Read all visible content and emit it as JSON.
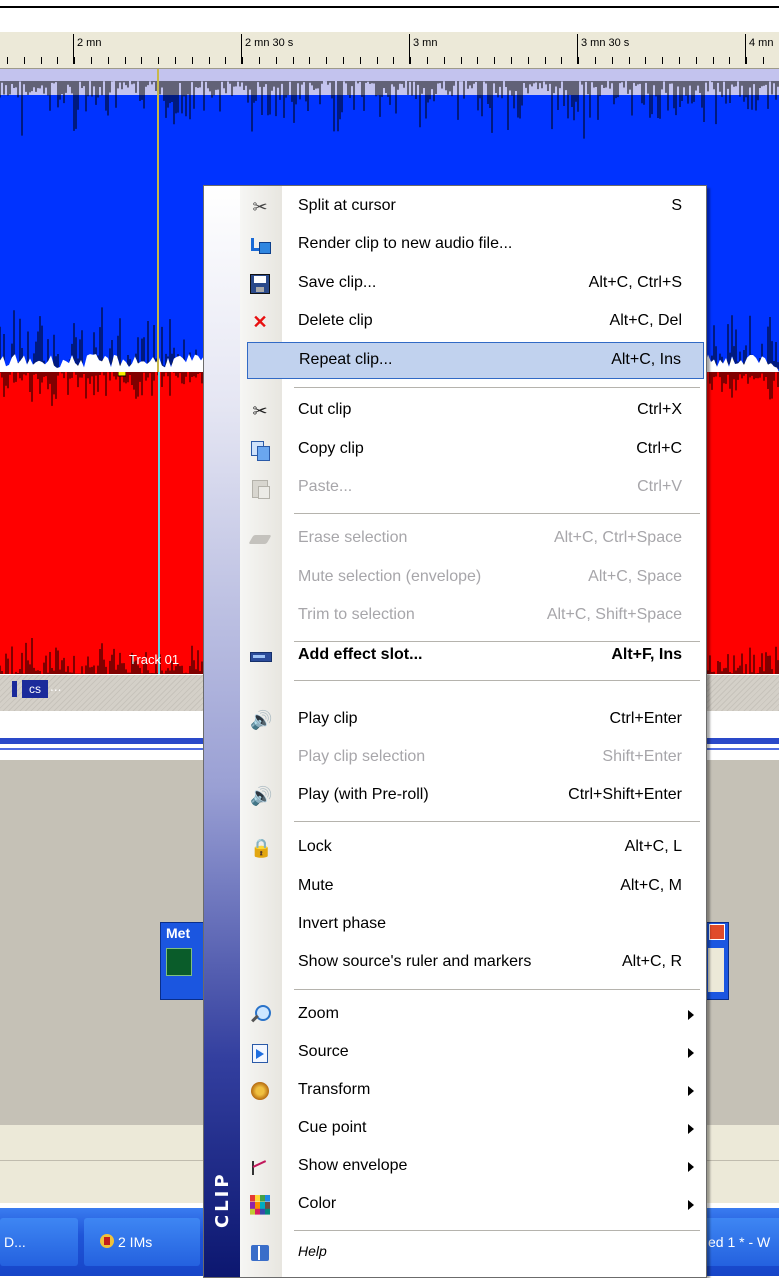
{
  "ruler": {
    "labels": [
      "2 mn",
      "2 mn 30 s",
      "3 mn",
      "3 mn 30 s",
      "4 mn"
    ]
  },
  "track": {
    "label": "Track 01",
    "clip_badge": "cs",
    "clip_more": "..."
  },
  "meter": {
    "title": "Met"
  },
  "taskbar": {
    "item_1": "D...",
    "item_2": "2 IMs",
    "item_3": "ed 1 * - W"
  },
  "menu": {
    "sidebar_title": "CLIP",
    "items": {
      "split_at_cursor": {
        "label": "Split at cursor",
        "shortcut": "S"
      },
      "render_clip": {
        "label": "Render clip to new audio file..."
      },
      "save_clip": {
        "label": "Save clip...",
        "shortcut": "Alt+C, Ctrl+S"
      },
      "delete_clip": {
        "label": "Delete clip",
        "shortcut": "Alt+C, Del"
      },
      "repeat_clip": {
        "label": "Repeat clip...",
        "shortcut": "Alt+C, Ins"
      },
      "cut_clip": {
        "label": "Cut clip",
        "shortcut": "Ctrl+X"
      },
      "copy_clip": {
        "label": "Copy clip",
        "shortcut": "Ctrl+C"
      },
      "paste": {
        "label": "Paste...",
        "shortcut": "Ctrl+V"
      },
      "erase_selection": {
        "label": "Erase selection",
        "shortcut": "Alt+C, Ctrl+Space"
      },
      "mute_selection": {
        "label": "Mute selection (envelope)",
        "shortcut": "Alt+C, Space"
      },
      "trim_selection": {
        "label": "Trim to selection",
        "shortcut": "Alt+C, Shift+Space"
      },
      "add_effect_slot": {
        "label": "Add effect slot...",
        "shortcut": "Alt+F, Ins"
      },
      "play_clip": {
        "label": "Play clip",
        "shortcut": "Ctrl+Enter"
      },
      "play_clip_selection": {
        "label": "Play clip selection",
        "shortcut": "Shift+Enter"
      },
      "play_preroll": {
        "label": "Play (with Pre-roll)",
        "shortcut": "Ctrl+Shift+Enter"
      },
      "lock": {
        "label": "Lock",
        "shortcut": "Alt+C, L"
      },
      "mute": {
        "label": "Mute",
        "shortcut": "Alt+C, M"
      },
      "invert_phase": {
        "label": "Invert phase"
      },
      "show_source_ruler": {
        "label": "Show source's ruler and markers",
        "shortcut": "Alt+C, R"
      },
      "zoom": {
        "label": "Zoom"
      },
      "source": {
        "label": "Source"
      },
      "transform": {
        "label": "Transform"
      },
      "cue_point": {
        "label": "Cue point"
      },
      "show_envelope": {
        "label": "Show envelope"
      },
      "color": {
        "label": "Color"
      },
      "help": {
        "label": "Help"
      }
    }
  },
  "colors": {
    "track_blue": "#0033ff",
    "track_red": "#ff0000",
    "highlight": "#c1d2ee",
    "highlight_border": "#316ac5",
    "disabled_text": "#a7a6aa"
  }
}
